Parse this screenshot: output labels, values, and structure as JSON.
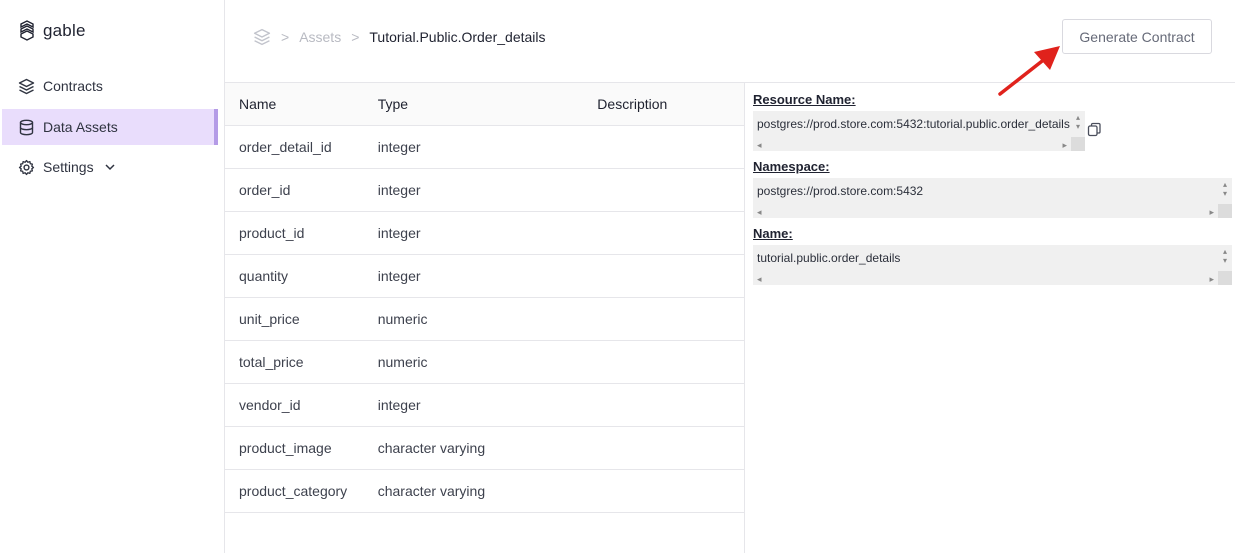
{
  "app": {
    "name": "gable"
  },
  "sidebar": {
    "items": [
      {
        "label": "Contracts",
        "icon": "layers-icon"
      },
      {
        "label": "Data Assets",
        "icon": "database-icon",
        "active": true
      },
      {
        "label": "Settings",
        "icon": "gear-icon",
        "expandable": true
      }
    ]
  },
  "breadcrumb": {
    "items": [
      "Assets",
      "Tutorial.Public.Order_details"
    ]
  },
  "header": {
    "generate_button": "Generate Contract"
  },
  "table": {
    "columns": [
      "Name",
      "Type",
      "Description"
    ],
    "rows": [
      {
        "name": "order_detail_id",
        "type": "integer",
        "description": ""
      },
      {
        "name": "order_id",
        "type": "integer",
        "description": ""
      },
      {
        "name": "product_id",
        "type": "integer",
        "description": ""
      },
      {
        "name": "quantity",
        "type": "integer",
        "description": ""
      },
      {
        "name": "unit_price",
        "type": "numeric",
        "description": ""
      },
      {
        "name": "total_price",
        "type": "numeric",
        "description": ""
      },
      {
        "name": "vendor_id",
        "type": "integer",
        "description": ""
      },
      {
        "name": "product_image",
        "type": "character varying",
        "description": ""
      },
      {
        "name": "product_category",
        "type": "character varying",
        "description": ""
      }
    ]
  },
  "details": {
    "resource_name_label": "Resource Name:",
    "resource_name_value": "postgres://prod.store.com:5432:tutorial.public.order_details",
    "namespace_label": "Namespace:",
    "namespace_value": "postgres://prod.store.com:5432",
    "name_label": "Name:",
    "name_value": "tutorial.public.order_details"
  },
  "colors": {
    "active_nav_bg": "#e9ddfc",
    "active_nav_border": "#b49be6",
    "annotation_arrow": "#e0221c"
  }
}
